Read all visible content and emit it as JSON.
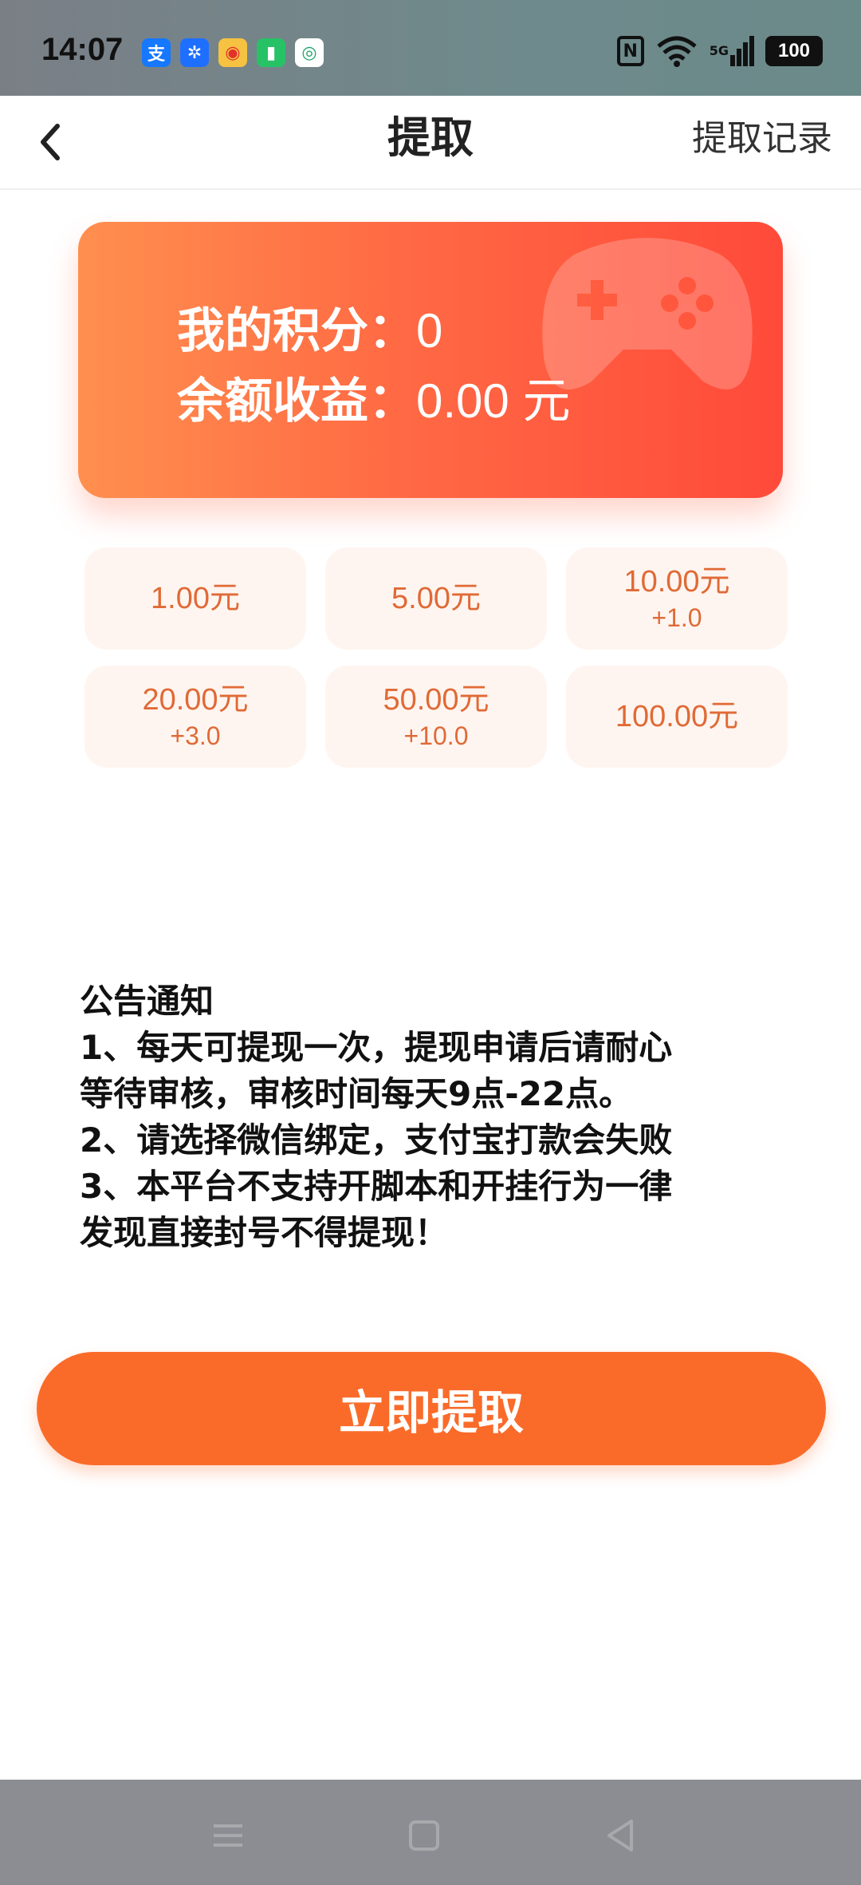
{
  "status_bar": {
    "time": "14:07",
    "apps": [
      {
        "name": "alipay-icon",
        "glyph": "支",
        "color": "#1677ff"
      },
      {
        "name": "pinwheel-app-icon",
        "glyph": "✲",
        "color": "#1f6fff"
      },
      {
        "name": "weibo-icon",
        "glyph": "◉",
        "color": "#f5c242"
      },
      {
        "name": "battery-app-icon",
        "glyph": "▮",
        "color": "#27c266"
      },
      {
        "name": "china-mobile-icon",
        "glyph": "◎",
        "color": "#ffffff"
      }
    ],
    "network_label": "5G",
    "battery": "100"
  },
  "header": {
    "title": "提取",
    "record_link": "提取记录"
  },
  "card": {
    "points_label": "我的积分：",
    "points_value": "0",
    "balance_label": "余额收益：",
    "balance_value": "0.00 元"
  },
  "amounts": [
    {
      "amount": "1.00元",
      "bonus": ""
    },
    {
      "amount": "5.00元",
      "bonus": ""
    },
    {
      "amount": "10.00元",
      "bonus": "+1.0"
    },
    {
      "amount": "20.00元",
      "bonus": "+3.0"
    },
    {
      "amount": "50.00元",
      "bonus": "+10.0"
    },
    {
      "amount": "100.00元",
      "bonus": ""
    }
  ],
  "notice": {
    "title": "公告通知",
    "lines": [
      "1、每天可提现一次，提现申请后请耐心",
      "等待审核，审核时间每天9点-22点。",
      "2、请选择微信绑定，支付宝打款会失败",
      "3、本平台不支持开脚本和开挂行为一律",
      "发现直接封号不得提现！"
    ]
  },
  "submit_label": "立即提取",
  "colors": {
    "accent": "#fa6b2a",
    "card_start": "#ff8f4f",
    "card_end": "#ff4a3a",
    "amount_text": "#e06a36",
    "amount_bg": "#fff5f0"
  }
}
